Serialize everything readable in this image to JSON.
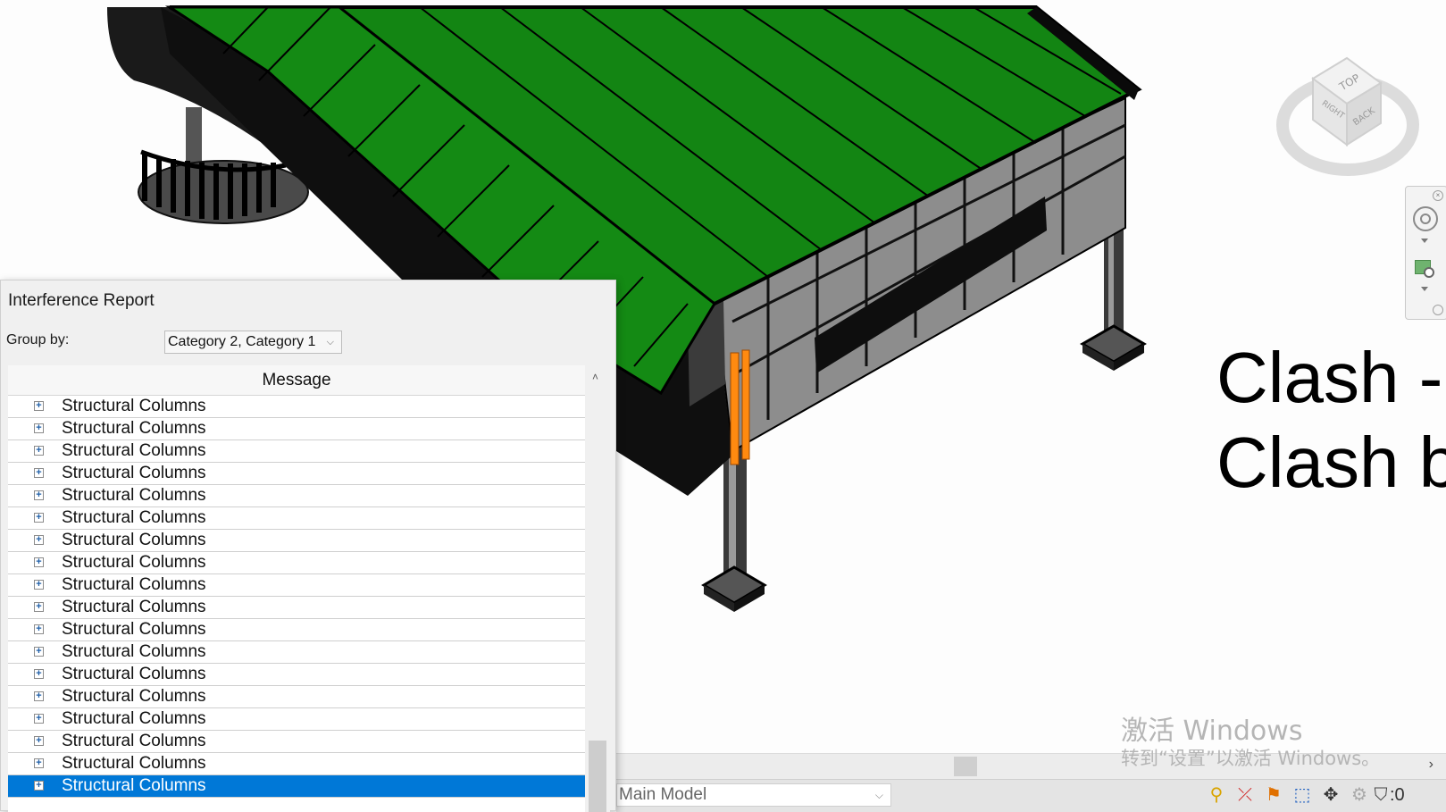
{
  "slide": {
    "line1": "Clash -",
    "line2": "Clash b"
  },
  "watermark": {
    "line1": "激活 Windows",
    "line2": "转到“设置”以激活 Windows。"
  },
  "viewcube": {
    "top": "TOP",
    "right": "RIGHT",
    "back": "BACK"
  },
  "colors": {
    "roof": "#138513",
    "clash_highlight": "#ff8a10",
    "selection": "#0078d7"
  },
  "interference_report": {
    "title": "Interference Report",
    "group_by_label": "Group by:",
    "group_by_value": "Category 2, Category 1",
    "column_header": "Message",
    "rows": [
      "Structural Columns",
      "Structural Columns",
      "Structural Columns",
      "Structural Columns",
      "Structural Columns",
      "Structural Columns",
      "Structural Columns",
      "Structural Columns",
      "Structural Columns",
      "Structural Columns",
      "Structural Columns",
      "Structural Columns",
      "Structural Columns",
      "Structural Columns",
      "Structural Columns",
      "Structural Columns",
      "Structural Columns",
      "Structural Columns"
    ],
    "selected_row_index": 17
  },
  "statusbar": {
    "model": "Main Model",
    "filter_count": ":0"
  },
  "icons": {
    "expander": "plus-box-icon",
    "sort": "chevron-up-icon",
    "dropdown": "chevron-down-icon",
    "nav_wheel": "steering-wheel-icon",
    "zoom": "zoom-region-icon",
    "filter": "filter-icon"
  }
}
